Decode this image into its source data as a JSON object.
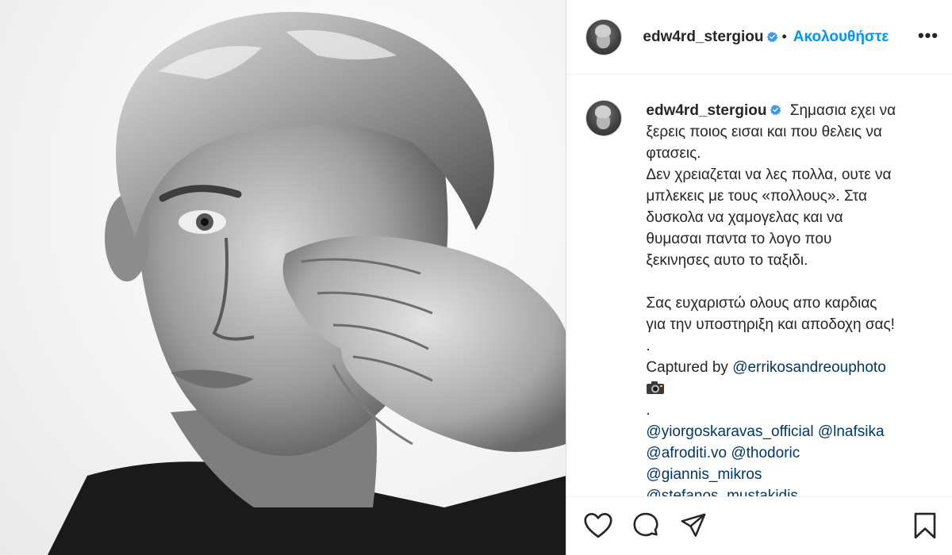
{
  "header": {
    "username": "edw4rd_stergiou",
    "separator": "•",
    "follow_label": "Ακολουθήστε",
    "more_label": "•••"
  },
  "caption": {
    "username": "edw4rd_stergiou",
    "lines": [
      "Σημασια εχει να",
      "ξερεις ποιος εισαι και που θελεις να",
      "φτασεις.",
      "Δεν χρειαζεται να λες πολλα, ουτε να",
      "μπλεκεις με τους «πολλους». Στα",
      "δυσκολα να χαμογελας και να",
      "θυμασαι παντα το λογο που",
      "ξεκινησες αυτο το ταξιδι.",
      "",
      "Σας ευχαριστώ ολους απο καρδιας",
      "για την υποστηριξη και αποδοχη σας!",
      "."
    ],
    "captured_by": "Captured by ",
    "photographer": "@errikosandreouphoto",
    "dot2": ".",
    "mentions_row1": [
      "@yiorgoskaravas_official",
      "@lnafsika"
    ],
    "mentions_row2": [
      "@afroditi.vo",
      "@thodoric"
    ],
    "mentions_row3": [
      "@giannis_mikros"
    ],
    "mentions_row4": [
      "@stefanos_mustakidis"
    ]
  },
  "icons": {
    "like": "heart-icon",
    "comment": "comment-icon",
    "share": "share-icon",
    "save": "bookmark-icon",
    "verified": "verified-badge-icon",
    "camera": "camera-icon"
  },
  "colors": {
    "accent": "#0095f6",
    "verified": "#3897f0",
    "mention": "#00376b",
    "text": "#262626"
  }
}
